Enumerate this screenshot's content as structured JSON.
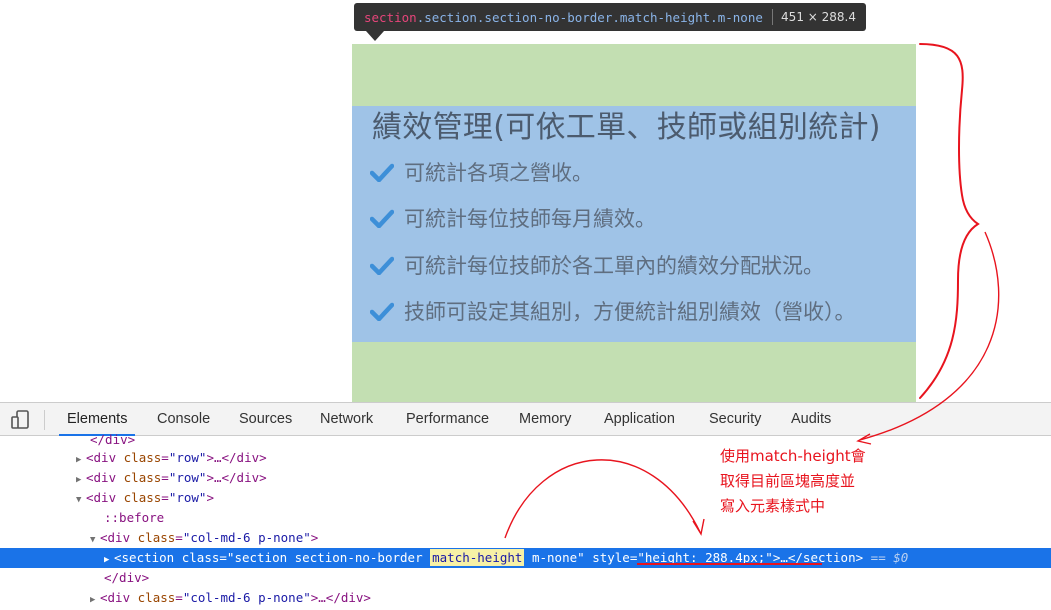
{
  "tooltip": {
    "tag": "section",
    "classes": ".section.section-no-border.match-height.m-none",
    "size": "451 × 288.4"
  },
  "section": {
    "title": "績效管理(可依工單、技師或組別統計)",
    "items": [
      "可統計各項之營收。",
      "可統計每位技師每月績效。",
      "可統計每位技師於各工單內的績效分配狀況。",
      "技師可設定其組別，方便統計組別績效（營收）。"
    ]
  },
  "devtools": {
    "tabs": [
      "Elements",
      "Console",
      "Sources",
      "Network",
      "Performance",
      "Memory",
      "Application",
      "Security",
      "Audits"
    ],
    "dom": {
      "close_div": "</div>",
      "row1": {
        "open": "<div",
        "attr": "class",
        "val": "\"row\"",
        "rest": ">…</div>"
      },
      "row2": {
        "open": "<div",
        "attr": "class",
        "val": "\"row\"",
        "rest": ">…</div>"
      },
      "row3": {
        "open": "<div",
        "attr": "class",
        "val": "\"row\"",
        "rest": ">"
      },
      "before": "::before",
      "col": {
        "open": "<div",
        "attr": "class",
        "val": "\"col-md-6 p-none\"",
        "rest": ">"
      },
      "selected": {
        "open": "<section",
        "attr": "class",
        "val_start": "\"section section-no-border ",
        "val_hl": "match-height",
        "val_end": " m-none\"",
        "style_attr": "style",
        "style_val": "\"height: 288.4px;\"",
        "rest": ">…</section>",
        "ref": "== $0"
      },
      "close_div2": "</div>",
      "col2": {
        "open": "<div",
        "attr": "class",
        "val": "\"col-md-6 p-none\"",
        "rest": ">…</div>"
      }
    }
  },
  "annotation": {
    "lines": [
      "使用match-height會",
      "取得目前區塊高度並",
      "寫入元素樣式中"
    ],
    "color": "#e8141e"
  },
  "colors": {
    "margin": "#c3dfb2",
    "content": "#9fc3e7",
    "check": "#3d8fd8",
    "selected_row": "#1a73e8"
  }
}
